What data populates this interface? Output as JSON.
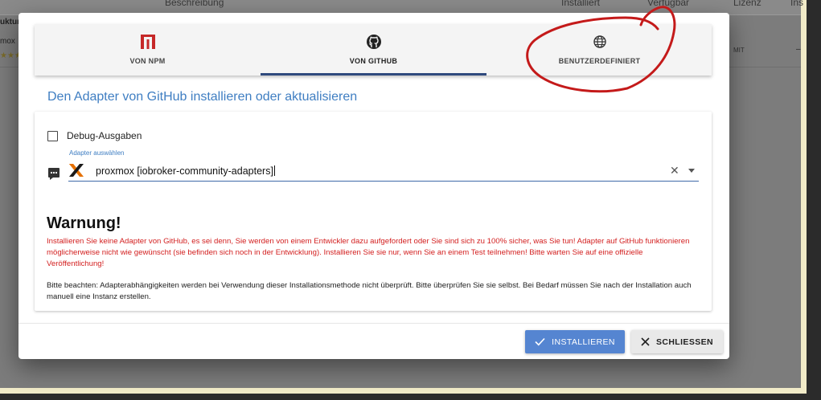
{
  "background": {
    "columns": [
      "Beschreibung",
      "Installiert",
      "Verfügbar",
      "Lizenz",
      "Ins"
    ],
    "row_fragment_top": "uktur",
    "row_fragment_name": "mox",
    "license_value": "MIT",
    "dash": "–"
  },
  "dialog": {
    "tabs": [
      {
        "label": "VON NPM",
        "icon": "npm-icon"
      },
      {
        "label": "VON GITHUB",
        "icon": "github-icon"
      },
      {
        "label": "BENUTZERDEFINIERT",
        "icon": "globe-icon"
      }
    ],
    "active_tab": "VON GITHUB",
    "title": "Den Adapter von GitHub installieren oder aktualisieren",
    "debug_checkbox": {
      "label": "Debug-Ausgaben",
      "checked": false
    },
    "adapter_select": {
      "label": "Adapter auswählen",
      "value": "proxmox [iobroker-community-adapters]"
    },
    "warning": {
      "title": "Warnung!",
      "text": "Installieren Sie keine Adapter von GitHub, es sei denn, Sie werden von einem Entwickler dazu aufgefordert oder Sie sind sich zu 100% sicher, was Sie tun! Adapter auf GitHub funktionieren möglicherweise nicht wie gewünscht (sie befinden sich noch in der Entwicklung). Installieren Sie sie nur, wenn Sie an einem Test teilnehmen! Bitte warten Sie auf eine offizielle Veröffentlichung!",
      "note": "Bitte beachten: Adapterabhängigkeiten werden bei Verwendung dieser Installationsmethode nicht überprüft. Bitte überprüfen Sie sie selbst. Bei Bedarf müssen Sie nach der Installation auch manuell eine Instanz erstellen."
    },
    "buttons": {
      "install": "INSTALLIEREN",
      "close": "SCHLIESSEN"
    }
  },
  "colors": {
    "accent": "#3f7ec2",
    "install_button": "#5585d1",
    "warning_text": "#d32020",
    "annotation_circle": "#c41a1a"
  }
}
